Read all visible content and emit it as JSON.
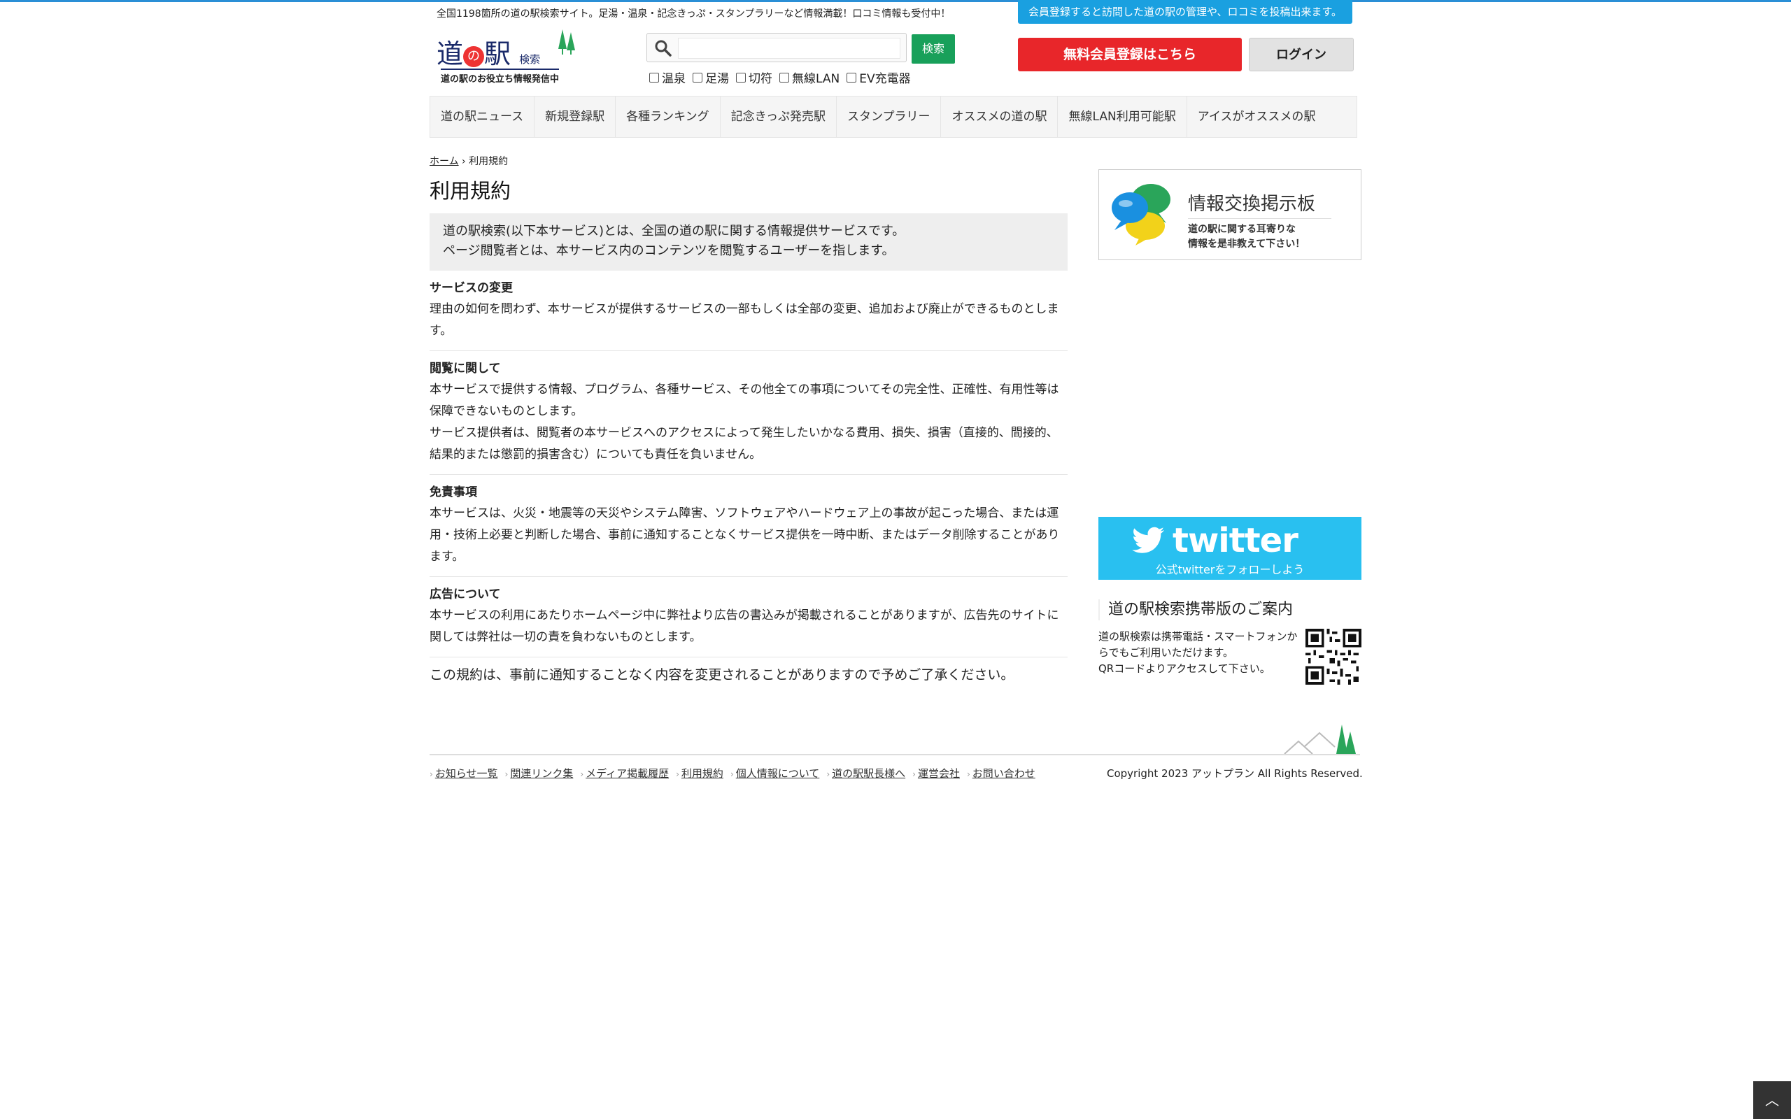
{
  "header": {
    "tagline": "全国1198箇所の道の駅検索サイト。足湯・温泉・記念きっぷ・スタンプラリーなど情報満載！口コミ情報も受付中！",
    "member_info": "会員登録すると訪問した道の駅の管理や、ロコミを投稿出来ます。",
    "logo": {
      "main": "道",
      "no": "の",
      "eki": "駅",
      "small": "検索",
      "sub": "道の駅のお役立ち情報発信中"
    },
    "search": {
      "placeholder": "",
      "button": "検索"
    },
    "filters": [
      "温泉",
      "足湯",
      "切符",
      "無線LAN",
      "EV充電器"
    ],
    "signup": "無料会員登録はこちら",
    "login": "ログイン"
  },
  "nav": [
    "道の駅ニュース",
    "新規登録駅",
    "各種ランキング",
    "記念きっぷ発売駅",
    "スタンプラリー",
    "オススメの道の駅",
    "無線LAN利用可能駅",
    "アイスがオススメの駅"
  ],
  "breadcrumb": {
    "home": "ホーム",
    "sep": "›",
    "current": "利用規約"
  },
  "page_title": "利用規約",
  "intro": [
    "道の駅検索(以下本サービス)とは、全国の道の駅に関する情報提供サービスです。",
    "ページ閲覧者とは、本サービス内のコンテンツを閲覧するユーザーを指します。"
  ],
  "sections": [
    {
      "heading": "サービスの変更",
      "paragraphs": [
        "理由の如何を問わず、本サービスが提供するサービスの一部もしくは全部の変更、追加および廃止ができるものとします。"
      ]
    },
    {
      "heading": "閲覧に関して",
      "paragraphs": [
        "本サービスで提供する情報、プログラム、各種サービス、その他全ての事項についてその完全性、正確性、有用性等は保障できないものとします。",
        "サービス提供者は、閲覧者の本サービスへのアクセスによって発生したいかなる費用、損失、損害（直接的、間接的、結果的または懲罰的損害含む）についても責任を負いません。"
      ]
    },
    {
      "heading": "免責事項",
      "paragraphs": [
        "本サービスは、火災・地震等の天災やシステム障害、ソフトウェアやハードウェア上の事故が起こった場合、または運用・技術上必要と判断した場合、事前に通知することなくサービス提供を一時中断、またはデータ削除することがあります。"
      ]
    },
    {
      "heading": "広告について",
      "paragraphs": [
        "本サービスの利用にあたりホームページ中に弊社より広告の書込みが掲載されることがありますが、広告先のサイトに関しては弊社は一切の責を負わないものとします。"
      ]
    }
  ],
  "closing": "この規約は、事前に通知することなく内容を変更されることがありますので予めご了承ください。",
  "sidebar": {
    "board": {
      "title": "情報交換掲示板",
      "sub1": "道の駅に関する耳寄りな",
      "sub2": "情報を是非教えて下さい！"
    },
    "twitter": {
      "logo": "twitter",
      "sub": "公式twitterをフォローしよう"
    },
    "mobile": {
      "title": "道の駅検索携帯版のご案内",
      "text1": "道の駅検索は携帯電話・スマートフォンか",
      "text2": "らでもご利用いただけます。",
      "text3": "QRコードよりアクセスして下さい。"
    }
  },
  "footer": {
    "links": [
      "お知らせ一覧",
      "関連リンク集",
      "メディア掲載履歴",
      "利用規約",
      "個人情報について",
      "道の駅駅長様へ",
      "運営会社",
      "お問い合わせ"
    ],
    "copyright": "Copyright 2023 アットプラン All Rights Reserved."
  },
  "pagetop": "︿",
  "colors": {
    "accent_blue": "#1aa0e0",
    "signup_red": "#e8262a",
    "search_green": "#18a05a",
    "twitter_blue": "#29c0f0"
  }
}
